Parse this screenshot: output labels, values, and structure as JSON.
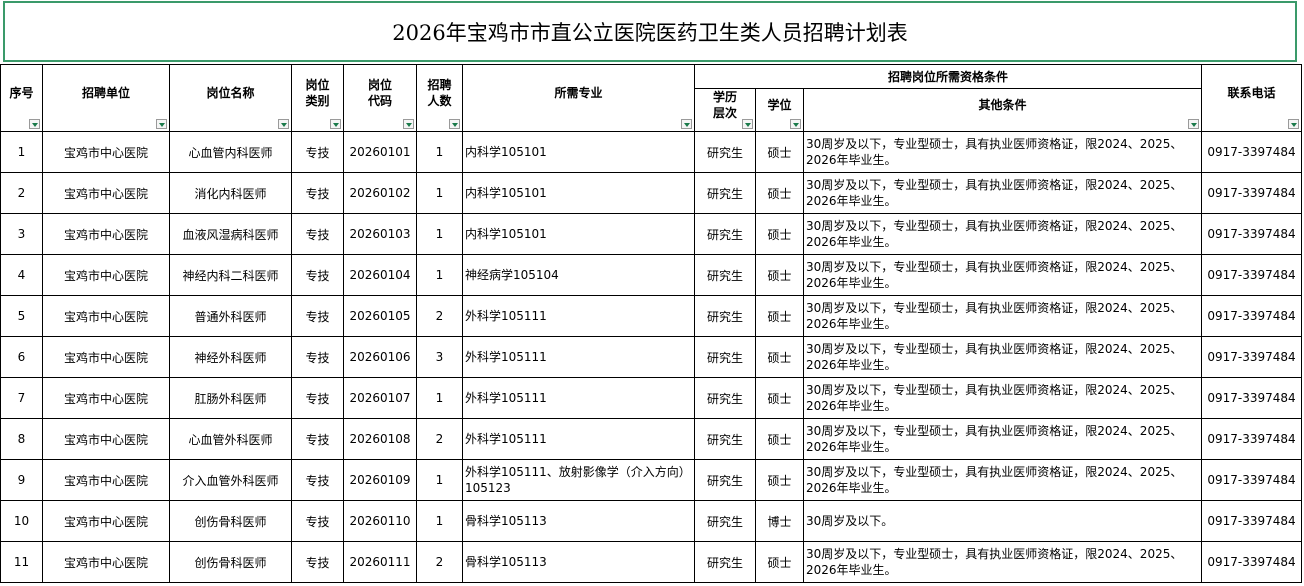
{
  "title": "2026年宝鸡市市直公立医院医药卫生类人员招聘计划表",
  "headers": {
    "seq": "序号",
    "unit": "招聘单位",
    "post_name": "岗位名称",
    "post_type": "岗位类别",
    "post_code": "岗位代码",
    "count": "招聘人数",
    "major": "所需专业",
    "qual_group": "招聘岗位所需资格条件",
    "education": "学历层次",
    "degree": "学位",
    "other": "其他条件",
    "phone": "联系电话"
  },
  "rows": [
    {
      "seq": "1",
      "unit": "宝鸡市中心医院",
      "post": "心血管内科医师",
      "type": "专技",
      "code": "20260101",
      "count": "1",
      "major": "内科学105101",
      "edu": "研究生",
      "degree": "硕士",
      "other": "30周岁及以下，专业型硕士，具有执业医师资格证，限2024、2025、2026年毕业生。",
      "phone": "0917-3397484"
    },
    {
      "seq": "2",
      "unit": "宝鸡市中心医院",
      "post": "消化内科医师",
      "type": "专技",
      "code": "20260102",
      "count": "1",
      "major": "内科学105101",
      "edu": "研究生",
      "degree": "硕士",
      "other": "30周岁及以下，专业型硕士，具有执业医师资格证，限2024、2025、2026年毕业生。",
      "phone": "0917-3397484"
    },
    {
      "seq": "3",
      "unit": "宝鸡市中心医院",
      "post": "血液风湿病科医师",
      "type": "专技",
      "code": "20260103",
      "count": "1",
      "major": "内科学105101",
      "edu": "研究生",
      "degree": "硕士",
      "other": "30周岁及以下，专业型硕士，具有执业医师资格证，限2024、2025、2026年毕业生。",
      "phone": "0917-3397484"
    },
    {
      "seq": "4",
      "unit": "宝鸡市中心医院",
      "post": "神经内科二科医师",
      "type": "专技",
      "code": "20260104",
      "count": "1",
      "major": "神经病学105104",
      "edu": "研究生",
      "degree": "硕士",
      "other": "30周岁及以下，专业型硕士，具有执业医师资格证，限2024、2025、2026年毕业生。",
      "phone": "0917-3397484"
    },
    {
      "seq": "5",
      "unit": "宝鸡市中心医院",
      "post": "普通外科医师",
      "type": "专技",
      "code": "20260105",
      "count": "2",
      "major": "外科学105111",
      "edu": "研究生",
      "degree": "硕士",
      "other": "30周岁及以下，专业型硕士，具有执业医师资格证，限2024、2025、2026年毕业生。",
      "phone": "0917-3397484"
    },
    {
      "seq": "6",
      "unit": "宝鸡市中心医院",
      "post": "神经外科医师",
      "type": "专技",
      "code": "20260106",
      "count": "3",
      "major": "外科学105111",
      "edu": "研究生",
      "degree": "硕士",
      "other": "30周岁及以下，专业型硕士，具有执业医师资格证，限2024、2025、2026年毕业生。",
      "phone": "0917-3397484"
    },
    {
      "seq": "7",
      "unit": "宝鸡市中心医院",
      "post": "肛肠外科医师",
      "type": "专技",
      "code": "20260107",
      "count": "1",
      "major": "外科学105111",
      "edu": "研究生",
      "degree": "硕士",
      "other": "30周岁及以下，专业型硕士，具有执业医师资格证，限2024、2025、2026年毕业生。",
      "phone": "0917-3397484"
    },
    {
      "seq": "8",
      "unit": "宝鸡市中心医院",
      "post": "心血管外科医师",
      "type": "专技",
      "code": "20260108",
      "count": "2",
      "major": "外科学105111",
      "edu": "研究生",
      "degree": "硕士",
      "other": "30周岁及以下，专业型硕士，具有执业医师资格证，限2024、2025、2026年毕业生。",
      "phone": "0917-3397484"
    },
    {
      "seq": "9",
      "unit": "宝鸡市中心医院",
      "post": "介入血管外科医师",
      "type": "专技",
      "code": "20260109",
      "count": "1",
      "major": "外科学105111、放射影像学（介入方向）105123",
      "edu": "研究生",
      "degree": "硕士",
      "other": "30周岁及以下，专业型硕士，具有执业医师资格证，限2024、2025、2026年毕业生。",
      "phone": "0917-3397484"
    },
    {
      "seq": "10",
      "unit": "宝鸡市中心医院",
      "post": "创伤骨科医师",
      "type": "专技",
      "code": "20260110",
      "count": "1",
      "major": "骨科学105113",
      "edu": "研究生",
      "degree": "博士",
      "other": "30周岁及以下。",
      "phone": "0917-3397484"
    },
    {
      "seq": "11",
      "unit": "宝鸡市中心医院",
      "post": "创伤骨科医师",
      "type": "专技",
      "code": "20260111",
      "count": "2",
      "major": "骨科学105113",
      "edu": "研究生",
      "degree": "硕士",
      "other": "30周岁及以下，专业型硕士，具有执业医师资格证，限2024、2025、2026年毕业生。",
      "phone": "0917-3397484"
    }
  ]
}
